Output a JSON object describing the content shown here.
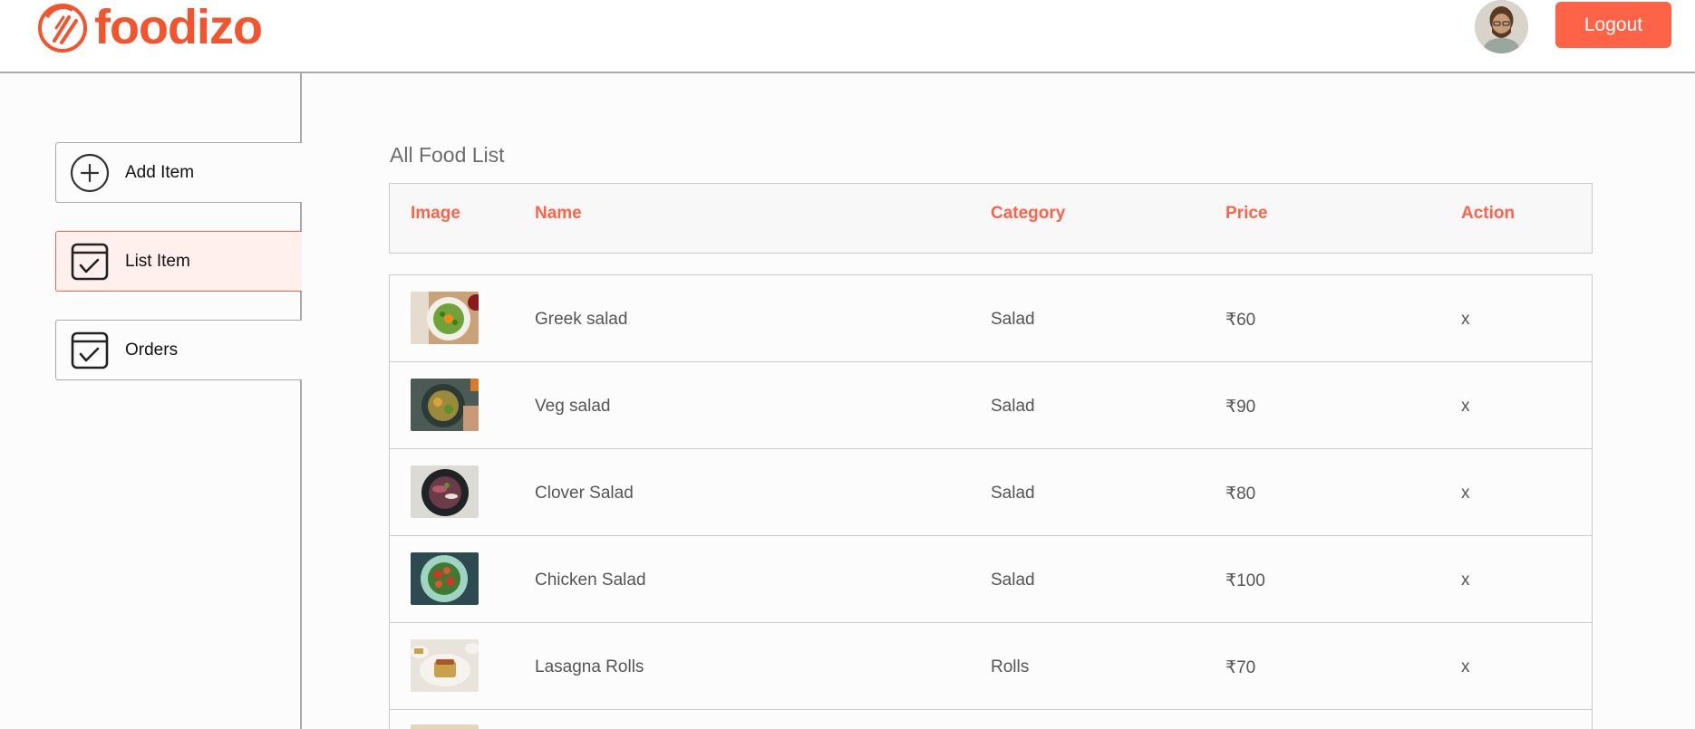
{
  "header": {
    "brand": "foodizo",
    "logout_label": "Logout",
    "brand_color": "#f4532b",
    "accent_color": "#ff6347"
  },
  "sidebar": {
    "items": [
      {
        "label": "Add Item",
        "icon": "plus-circle-icon",
        "active": false
      },
      {
        "label": "List Item",
        "icon": "checklist-icon",
        "active": true
      },
      {
        "label": "Orders",
        "icon": "checklist-icon",
        "active": false
      }
    ]
  },
  "main": {
    "title": "All Food List",
    "columns": [
      "Image",
      "Name",
      "Category",
      "Price",
      "Action"
    ],
    "rows": [
      {
        "name": "Greek salad",
        "category": "Salad",
        "price": "₹60",
        "action": "x"
      },
      {
        "name": "Veg salad",
        "category": "Salad",
        "price": "₹90",
        "action": "x"
      },
      {
        "name": "Clover Salad",
        "category": "Salad",
        "price": "₹80",
        "action": "x"
      },
      {
        "name": "Chicken Salad",
        "category": "Salad",
        "price": "₹100",
        "action": "x"
      },
      {
        "name": "Lasagna Rolls",
        "category": "Rolls",
        "price": "₹70",
        "action": "x"
      }
    ]
  }
}
